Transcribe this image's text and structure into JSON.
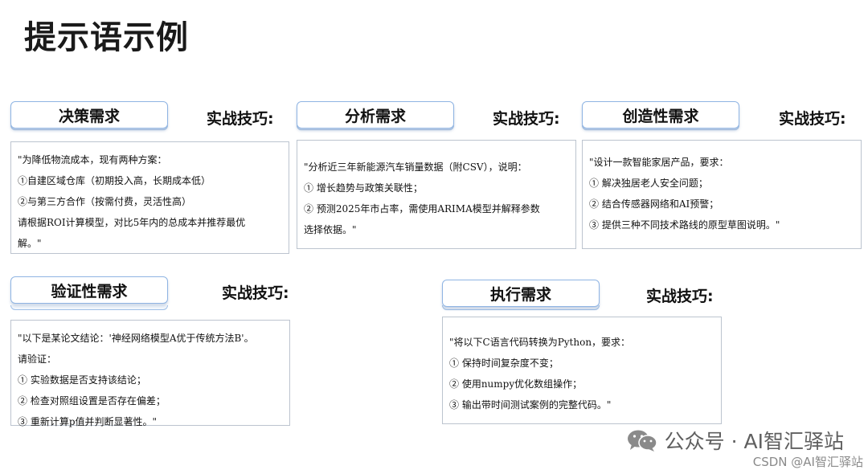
{
  "page": {
    "title": "提示语示例"
  },
  "tip_label": "实战技巧:",
  "cards": [
    {
      "id": "decision",
      "heading": "决策需求",
      "lines": [
        "\"为降低物流成本，现有两种方案：",
        "①自建区域仓库（初期投入高，长期成本低）",
        "②与第三方合作（按需付费，灵活性高）",
        "请根据ROI计算模型，对比5年内的总成本并推荐最优",
        "解。\""
      ]
    },
    {
      "id": "analysis",
      "heading": "分析需求",
      "lines": [
        "\"分析近三年新能源汽车销量数据（附CSV），说明：",
        "① 增长趋势与政策关联性；",
        "② 预测2025年市占率，需使用ARIMA模型并解释参数",
        "选择依据。\""
      ]
    },
    {
      "id": "creative",
      "heading": "创造性需求",
      "lines": [
        "\"设计一款智能家居产品，要求：",
        "① 解决独居老人安全问题；",
        "② 结合传感器网络和AI预警；",
        "③ 提供三种不同技术路线的原型草图说明。\""
      ]
    },
    {
      "id": "verification",
      "heading": "验证性需求",
      "lines": [
        "\"以下是某论文结论：'神经网络模型A优于传统方法B'。",
        "请验证：",
        "① 实验数据是否支持该结论；",
        "② 检查对照组设置是否存在偏差；",
        "③ 重新计算p值并判断显著性。\""
      ]
    },
    {
      "id": "execution",
      "heading": "执行需求",
      "lines": [
        "\"将以下C语言代码转换为Python，要求：",
        "① 保持时间复杂度不变；",
        "② 使用numpy优化数组操作；",
        "③ 输出带时间测试案例的完整代码。\""
      ]
    }
  ],
  "watermark": {
    "icon": "wechat-icon",
    "text": "公众号 · AI智汇驿站",
    "csdn": "CSDN @AI智汇驿站"
  },
  "colors": {
    "tab_border": "#8fb4e3",
    "content_border": "#bcc4cf",
    "watermark_text": "#5f5f5f"
  }
}
